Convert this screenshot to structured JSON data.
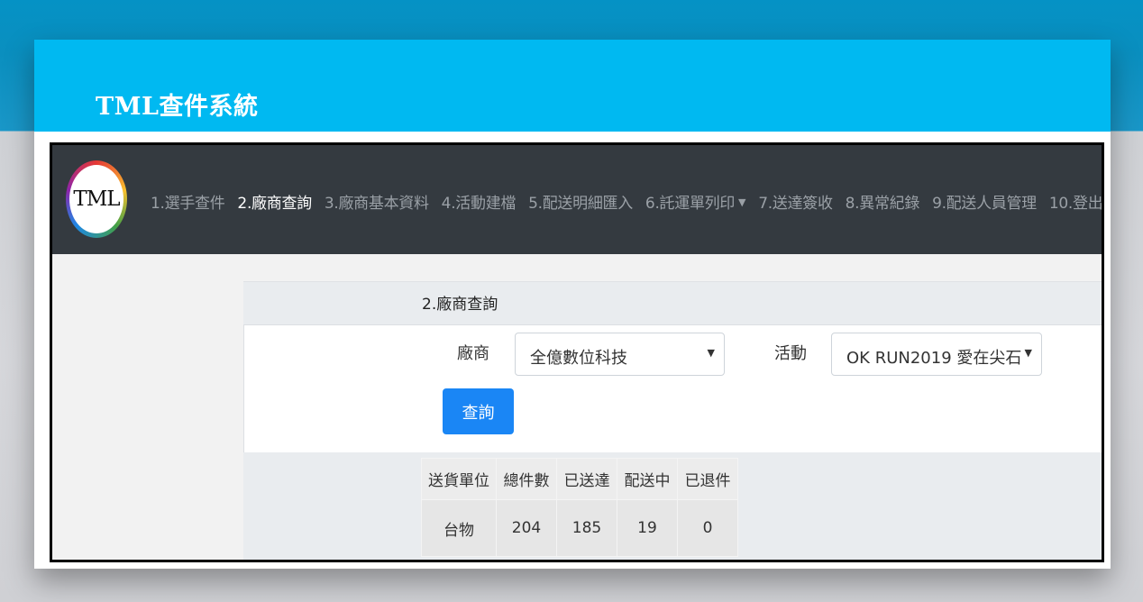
{
  "banner": {
    "title": "TML查件系統"
  },
  "app": {
    "logo_text": "TML",
    "nav": [
      {
        "label": "1.選手查件",
        "active": false
      },
      {
        "label": "2.廠商查詢",
        "active": true
      },
      {
        "label": "3.廠商基本資料",
        "active": false
      },
      {
        "label": "4.活動建檔",
        "active": false
      },
      {
        "label": "5.配送明細匯入",
        "active": false
      },
      {
        "label": "6.託運單列印",
        "active": false,
        "dropdown": true
      },
      {
        "label": "7.送達簽收",
        "active": false
      },
      {
        "label": "8.異常紀錄",
        "active": false
      },
      {
        "label": "9.配送人員管理",
        "active": false
      },
      {
        "label": "10.登出",
        "active": false
      }
    ],
    "panel_title": "2.廠商查詢",
    "form": {
      "vendor_label": "廠商",
      "vendor_value": "全億數位科技",
      "activity_label": "活動",
      "activity_value": "OK RUN2019 愛在尖石",
      "query_button": "查詢"
    },
    "table": {
      "headers": [
        "送貨單位",
        "總件數",
        "已送達",
        "配送中",
        "已退件"
      ],
      "rows": [
        [
          "台物",
          "204",
          "185",
          "19",
          "0"
        ]
      ]
    }
  },
  "colors": {
    "banner": "#00b9f1",
    "navbar": "#343a40",
    "button": "#1a86f5"
  }
}
